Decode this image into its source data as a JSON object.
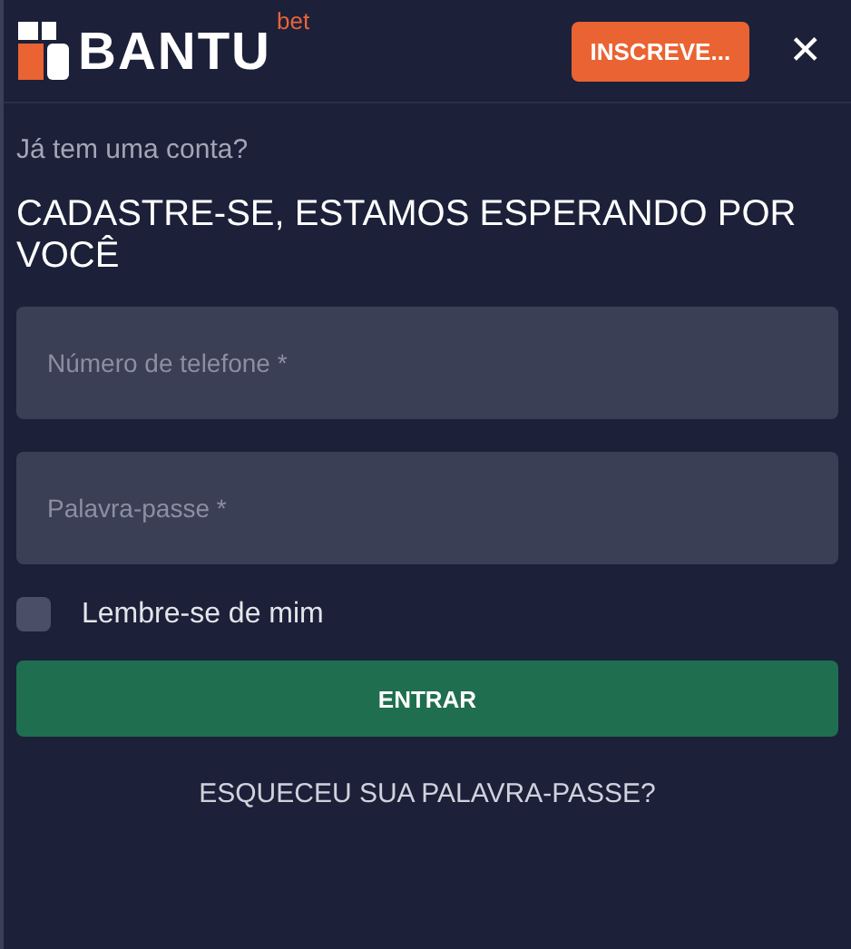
{
  "header": {
    "logo": {
      "name": "BANTU",
      "suffix": "bet"
    },
    "register_button": "INSCREVE...",
    "close": "✕"
  },
  "prompt": "Já tem uma conta?",
  "heading": "CADASTRE-SE, ESTAMOS ESPERANDO POR VOCÊ",
  "fields": [
    {
      "placeholder": "Número de telefone *"
    },
    {
      "placeholder": "Palavra-passe *"
    }
  ],
  "remember": {
    "label": "Lembre-se de mim",
    "checked": false
  },
  "submit_button": "ENTRAR",
  "forgot_link": "ESQUECEU SUA PALAVRA-PASSE?"
}
